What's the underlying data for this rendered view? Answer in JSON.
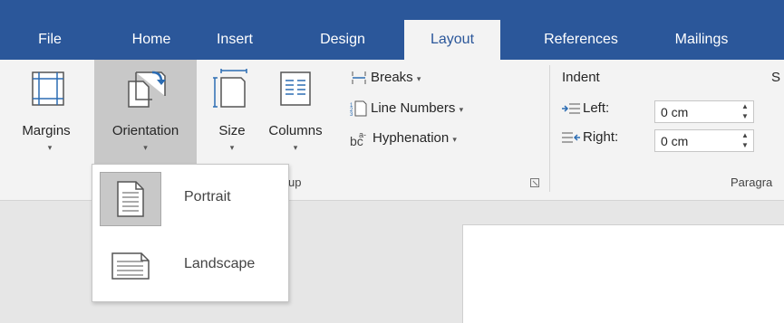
{
  "tabs": [
    {
      "label": "File"
    },
    {
      "label": "Home"
    },
    {
      "label": "Insert"
    },
    {
      "label": "Design"
    },
    {
      "label": "Layout"
    },
    {
      "label": "References"
    },
    {
      "label": "Mailings"
    }
  ],
  "active_tab": "Layout",
  "page_setup": {
    "margins_label": "Margins",
    "orientation_label": "Orientation",
    "size_label": "Size",
    "columns_label": "Columns",
    "breaks_label": "Breaks",
    "line_numbers_label": "Line Numbers",
    "hyphenation_label": "Hyphenation",
    "group_label": "up",
    "caret": "▾"
  },
  "paragraph": {
    "indent_label": "Indent",
    "spacing_label_partial": "S",
    "left_label": "Left:",
    "left_value": "0 cm",
    "right_label": "Right:",
    "right_value": "0 cm",
    "group_label": "Paragra"
  },
  "orientation_menu": {
    "items": [
      {
        "label": "Portrait",
        "selected": true
      },
      {
        "label": "Landscape",
        "selected": false
      }
    ]
  },
  "colors": {
    "tab_bar": "#2b579a",
    "ribbon": "#f3f3f3",
    "highlight": "#c8c8c8"
  }
}
